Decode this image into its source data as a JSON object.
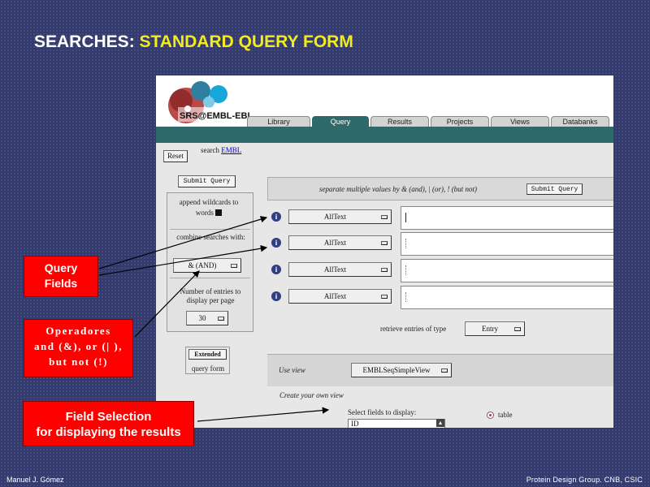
{
  "slide": {
    "title_prefix": "SEARCHES:",
    "title_accent": "STANDARD QUERY FORM",
    "footer_left": "Manuel J. Gómez",
    "footer_right": "Protein Design Group. CNB, CSIC"
  },
  "srs": {
    "logo_text": "SRS@EMBL-EBI",
    "tabs": [
      {
        "label": "Library",
        "active": false
      },
      {
        "label": "Query",
        "active": true
      },
      {
        "label": "Results",
        "active": false
      },
      {
        "label": "Projects",
        "active": false
      },
      {
        "label": "Views",
        "active": false
      },
      {
        "label": "Databanks",
        "active": false
      }
    ],
    "reset_label": "Reset",
    "search_label": "search",
    "search_db": "EMBL",
    "left_panel": {
      "submit_label": "Submit Query",
      "wildcards_label": "append wildcards to words",
      "combine_label": "combine searches with:",
      "combine_value": "& (AND)",
      "entries_label": "Number of entries to display per page",
      "entries_value": "30",
      "extended_label": "Extended",
      "query_form_label": "query form"
    },
    "query": {
      "hint": "separate multiple values by & (and), | (or), ! (but not)",
      "submit_label": "Submit Query",
      "fields": [
        {
          "icon": "i",
          "select": "AllText",
          "value": ""
        },
        {
          "icon": "i",
          "select": "AllText",
          "value": ""
        },
        {
          "icon": "i",
          "select": "AllText",
          "value": ""
        },
        {
          "icon": "i",
          "select": "AllText",
          "value": ""
        }
      ],
      "retrieve_label": "retrieve entries of type",
      "retrieve_value": "Entry",
      "use_view_label": "Use view",
      "view_value": "EMBLSeqSimpleView",
      "create_view_label": "Create your own view",
      "select_fields_label": "Select fields to display:",
      "fields_list_value": "ID",
      "output_option": "table"
    }
  },
  "callouts": {
    "query_fields": "Query\nFields",
    "operators": "Operadores\nand (&), or (| ),\nbut not (!)",
    "field_selection": "Field Selection\nfor displaying the results"
  },
  "colors": {
    "background": "#333a6e",
    "title_accent": "#f2ec1f",
    "callout": "#ff0000",
    "srs_teal": "#2f6a6a"
  }
}
